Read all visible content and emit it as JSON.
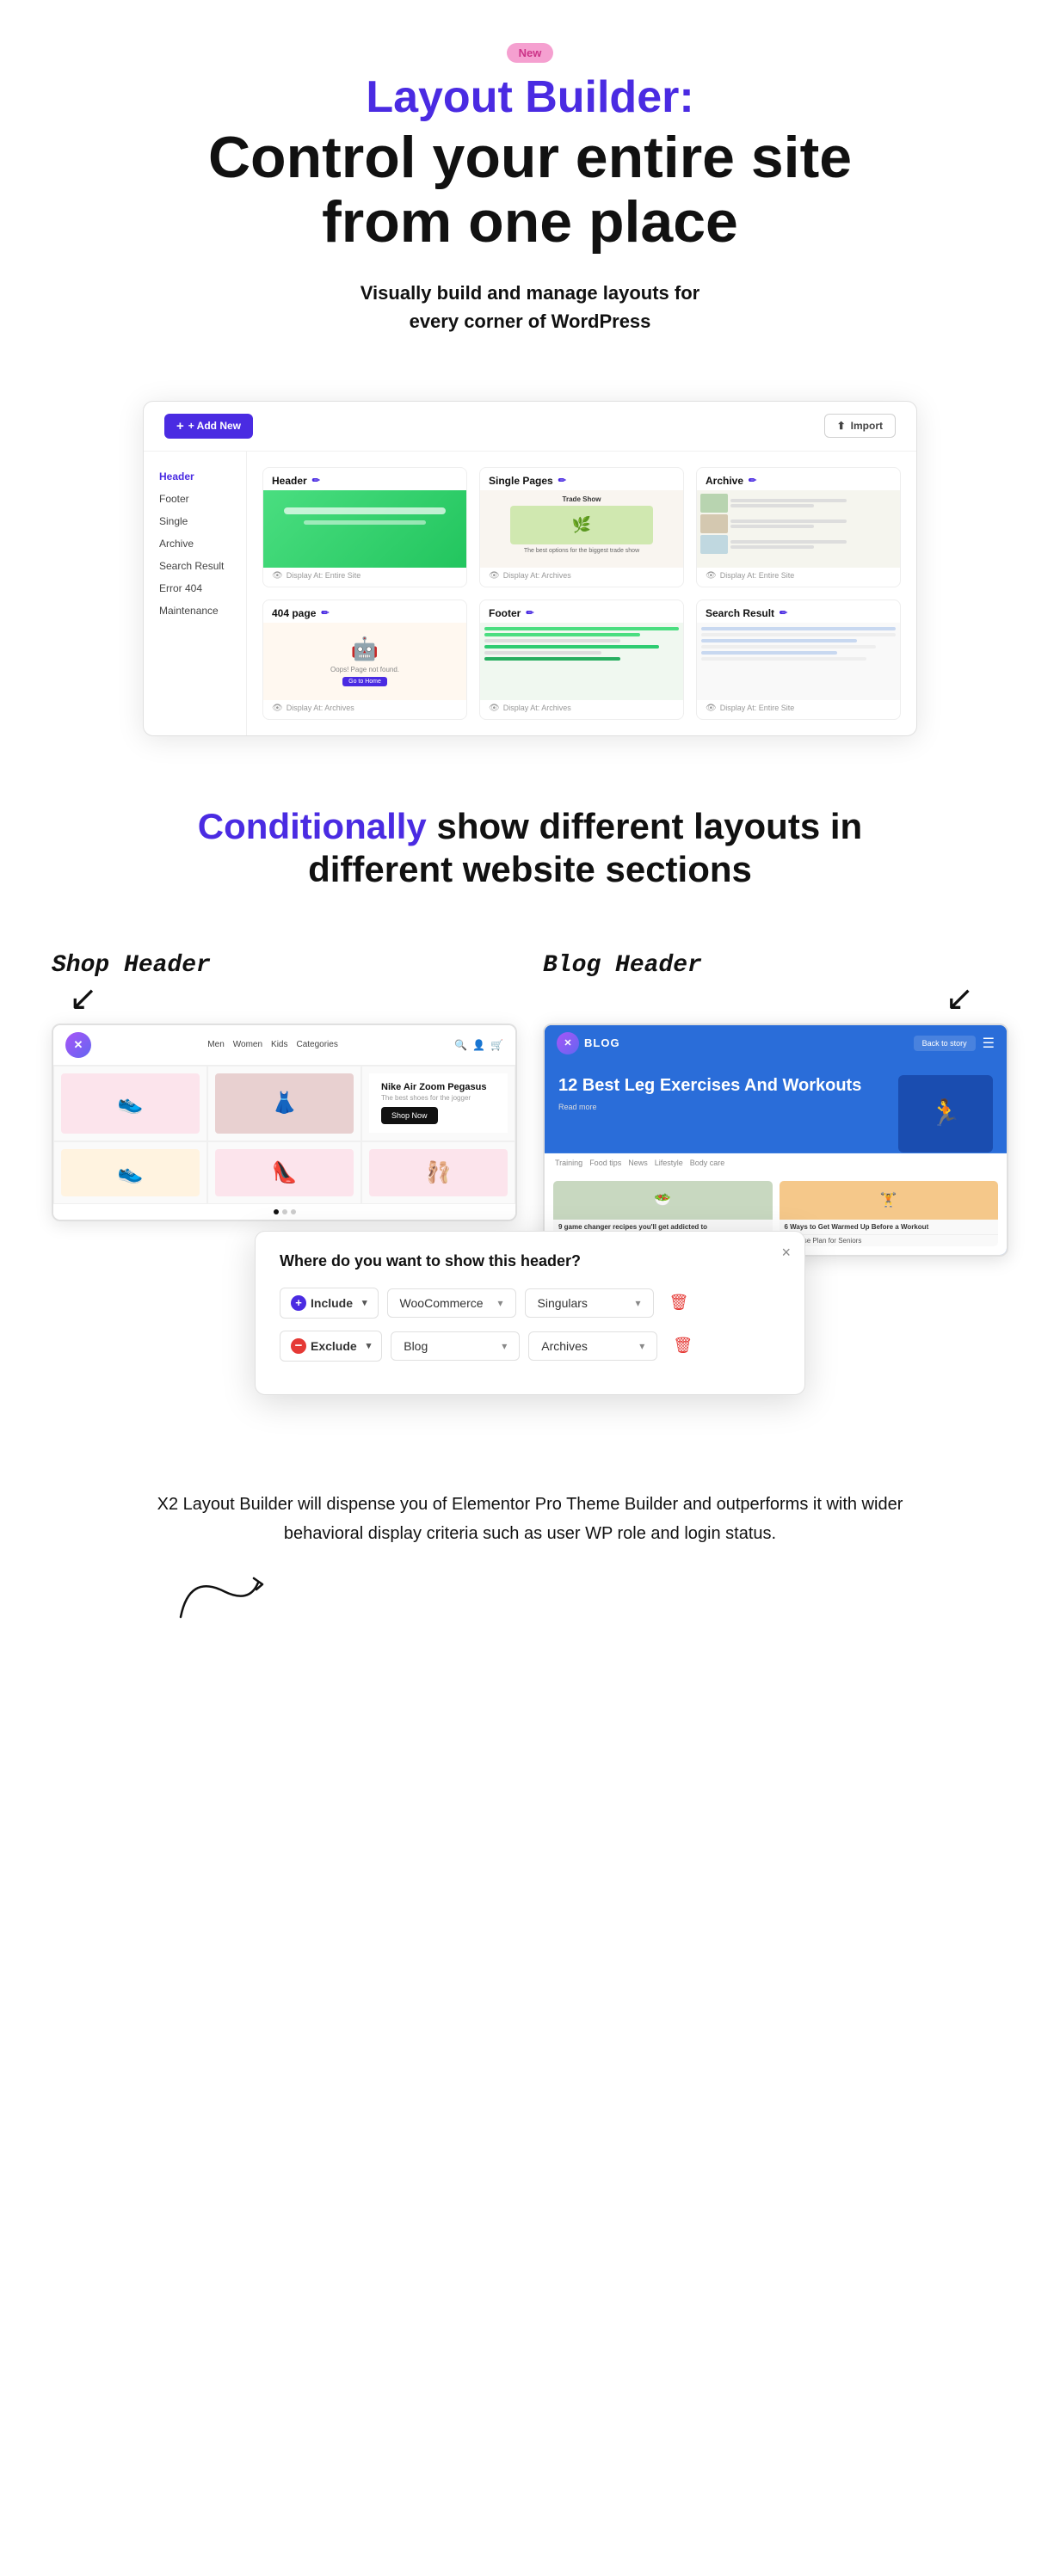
{
  "badge": {
    "label": "New"
  },
  "hero": {
    "title_colored": "Layout Builder:",
    "title_black_line1": "Control your entire site",
    "title_black_line2": "from one place",
    "subtitle_line1": "Visually build and manage layouts for",
    "subtitle_line2": "every corner of WordPress"
  },
  "mockup": {
    "add_btn": "+ Add New",
    "import_btn": "Import",
    "sidebar_items": [
      "Header",
      "Footer",
      "Single",
      "Archive",
      "Search Result",
      "Error 404",
      "Maintenance"
    ],
    "cards": [
      {
        "title": "Header",
        "footer": "Display At: Entire Site"
      },
      {
        "title": "Single Pages",
        "footer": "Display At: Archives"
      },
      {
        "title": "Archive",
        "footer": "Display At: Entire Site"
      },
      {
        "title": "404 page",
        "footer": "Display At: Archives"
      },
      {
        "title": "Footer",
        "footer": "Display At: Archives"
      },
      {
        "title": "Search Result",
        "footer": "Display At: Entire Site"
      }
    ]
  },
  "conditional": {
    "title_part1": "Conditionally",
    "title_part2": " show different layouts in",
    "title_line2": "different website sections"
  },
  "headers_demo": {
    "shop_label": "Shop Header",
    "blog_label": "Blog Header",
    "shop_nav": [
      "Men",
      "Women",
      "Kids",
      "Categories"
    ],
    "shop_product_name": "Nike Air Zoom Pegasus",
    "shop_product_desc": "The best shoes for the jogger",
    "shop_cta": "Shop Now",
    "blog_title": "12 Best Leg Exercises And Workouts",
    "blog_read_more": "Read more",
    "blog_post1": "9 game changer recipes you'll get addicted to",
    "blog_post2": "6 Ways to Get Warmed Up Before a Workout",
    "blog_post3": "Exercise Plan for Seniors"
  },
  "dialog": {
    "title": "Where do you want to show this header?",
    "close_label": "×",
    "row1": {
      "type": "Include",
      "category": "WooCommerce",
      "scope": "Singulars"
    },
    "row2": {
      "type": "Exclude",
      "category": "Blog",
      "scope": "Archives"
    }
  },
  "bottom": {
    "text": "X2 Layout Builder will dispense you of Elementor Pro Theme Builder and outperforms it with wider behavioral display criteria such as user WP role and login status."
  }
}
